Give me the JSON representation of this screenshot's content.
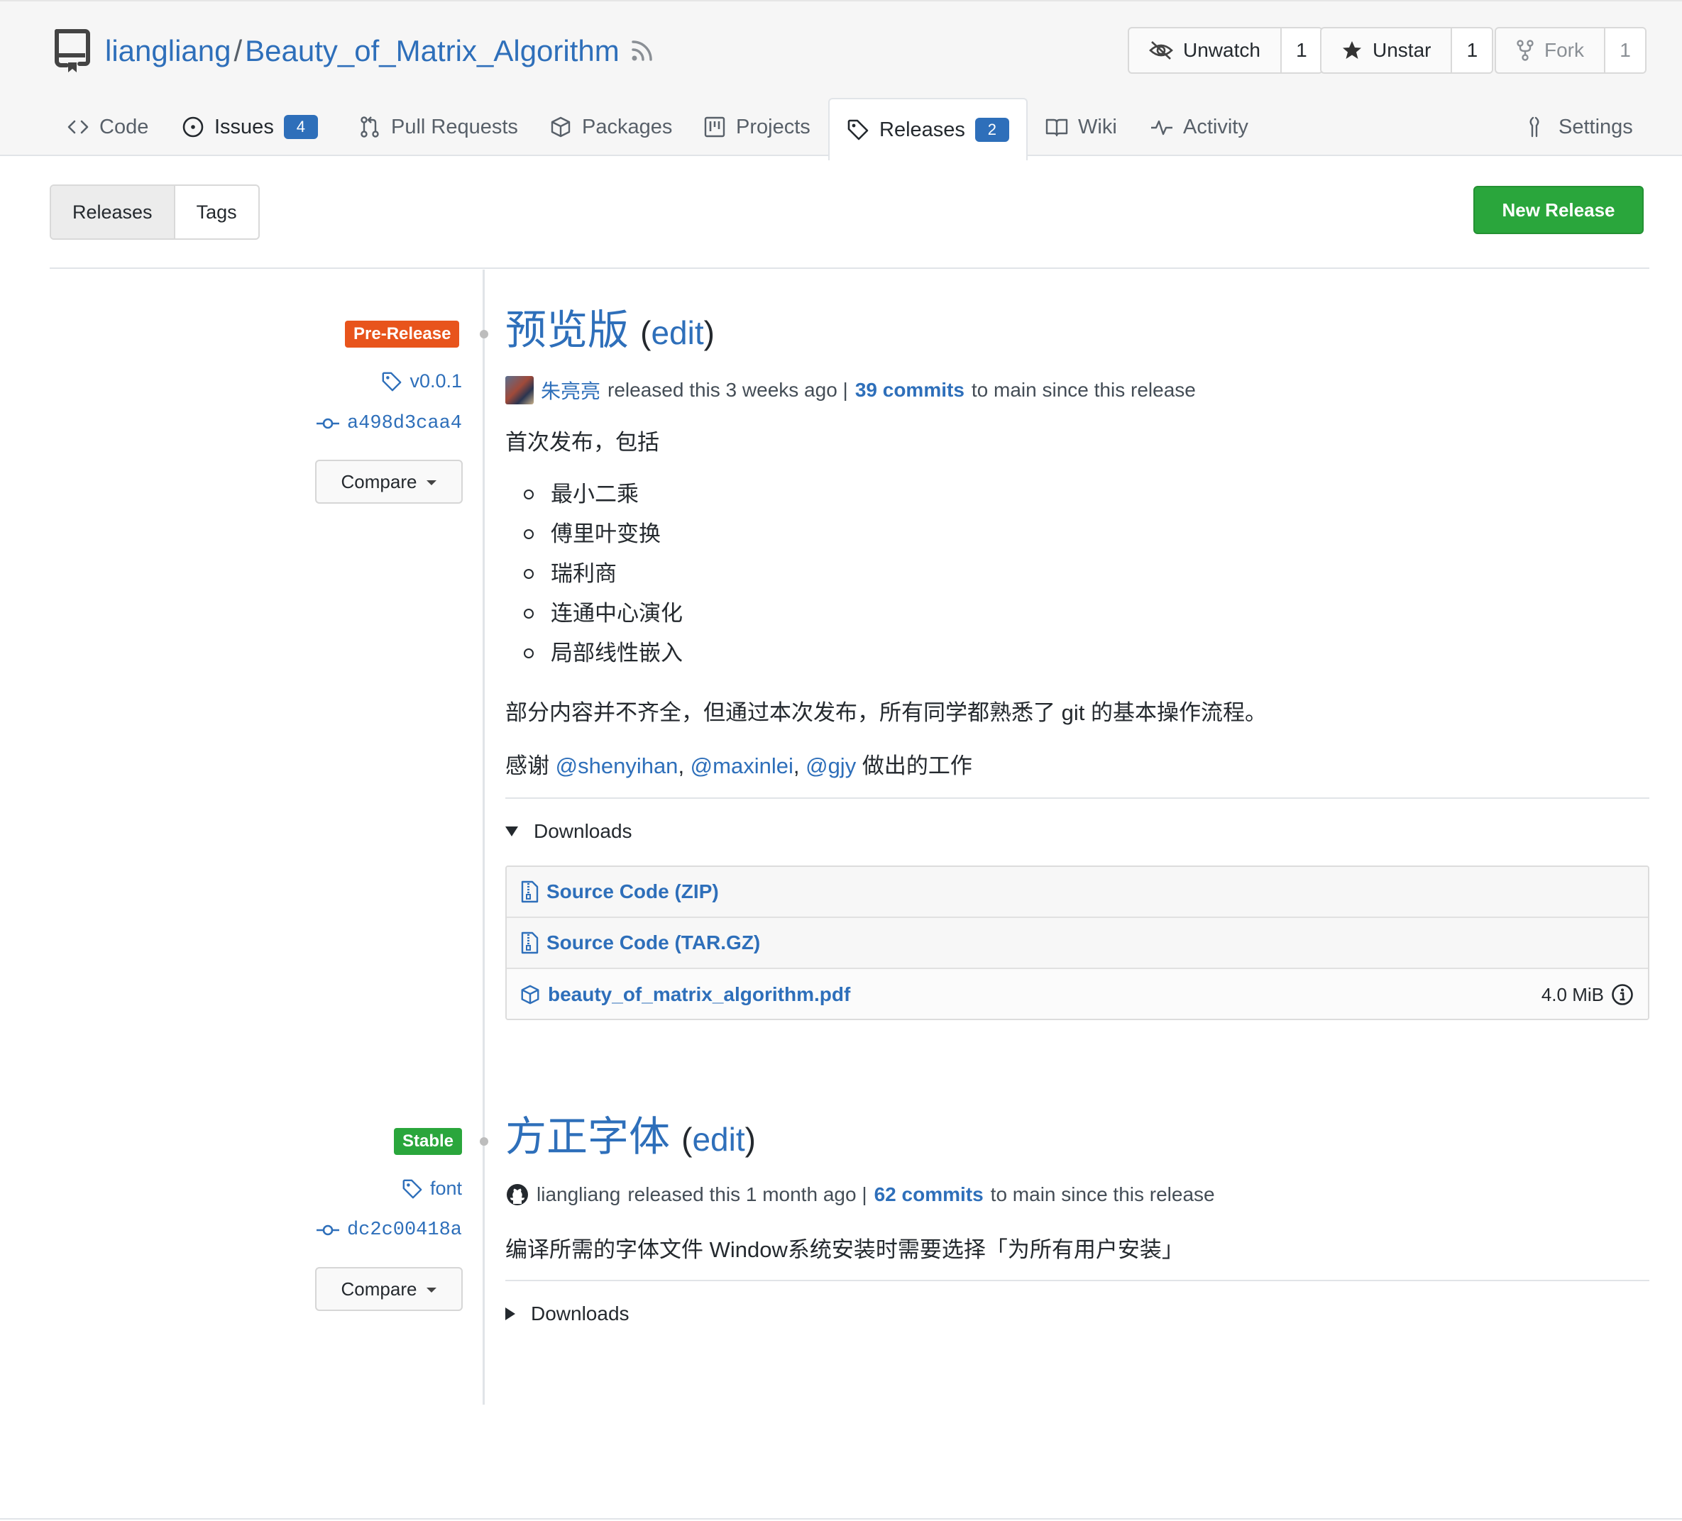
{
  "header": {
    "owner": "liangliang",
    "separator": "/",
    "repo": "Beauty_of_Matrix_Algorithm",
    "watch": {
      "label": "Unwatch",
      "count": "1"
    },
    "star": {
      "label": "Unstar",
      "count": "1"
    },
    "fork": {
      "label": "Fork",
      "count": "1"
    }
  },
  "tabs": {
    "code": "Code",
    "issues": {
      "label": "Issues",
      "count": "4"
    },
    "pulls": "Pull Requests",
    "packages": "Packages",
    "projects": "Projects",
    "releases": {
      "label": "Releases",
      "count": "2"
    },
    "wiki": "Wiki",
    "activity": "Activity",
    "settings": "Settings"
  },
  "subnav": {
    "releases": "Releases",
    "tags": "Tags",
    "new_release": "New Release"
  },
  "releases": [
    {
      "badge": "Pre-Release",
      "badge_color": "#e8541c",
      "tag": "v0.0.1",
      "commit": "a498d3caa4",
      "compare": "Compare",
      "title": "预览版",
      "edit": "edit",
      "author": "朱亮亮",
      "released_text": "released this 3 weeks ago |",
      "commits": "39 commits",
      "since_text": "to main since this release",
      "intro": "首次发布，包括",
      "bullets": [
        "最小二乘",
        "傅里叶变换",
        "瑞利商",
        "连通中心演化",
        "局部线性嵌入"
      ],
      "note": "部分内容并不齐全，但通过本次发布，所有同学都熟悉了 git 的基本操作流程。",
      "thanks_prefix": "感谢",
      "mentions": [
        "@shenyihan",
        "@maxinlei",
        "@gjy"
      ],
      "thanks_suffix": "做出的工作",
      "downloads_label": "Downloads",
      "downloads": [
        {
          "name": "Source Code (ZIP)",
          "icon": "file-zip-icon"
        },
        {
          "name": "Source Code (TAR.GZ)",
          "icon": "file-zip-icon"
        },
        {
          "name": "beauty_of_matrix_algorithm.pdf",
          "icon": "package-icon",
          "size": "4.0 MiB"
        }
      ]
    },
    {
      "badge": "Stable",
      "badge_color": "#2aa63c",
      "tag": "font",
      "commit": "dc2c00418a",
      "compare": "Compare",
      "title": "方正字体",
      "edit": "edit",
      "author": "liangliang",
      "released_text": "released this 1 month ago |",
      "commits": "62 commits",
      "since_text": "to main since this release",
      "intro": "编译所需的字体文件 Window系统安装时需要选择「为所有用户安装」",
      "downloads_label": "Downloads"
    }
  ]
}
